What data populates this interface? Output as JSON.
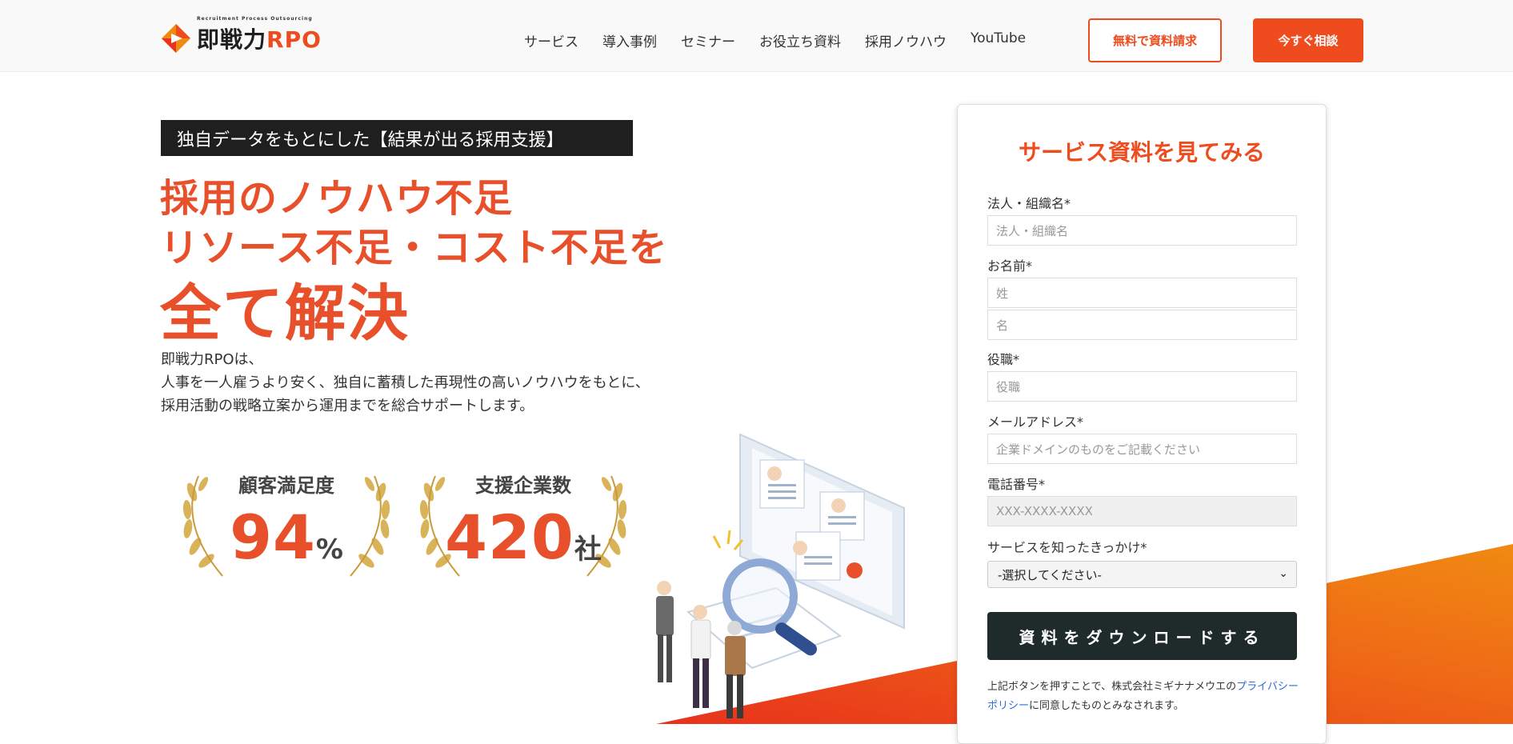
{
  "header": {
    "logo_sub": "Recruitment Process Outsourcing",
    "logo_main_a": "即戦力",
    "logo_main_b": "RPO",
    "nav": [
      "サービス",
      "導入事例",
      "セミナー",
      "お役立ち資料",
      "採用ノウハウ",
      "YouTube"
    ],
    "btn_request": "無料で資料請求",
    "btn_consult": "今すぐ相談"
  },
  "hero": {
    "tagline": "独自データをもとにした【結果が出る採用支援】",
    "headline_line1": "採用のノウハウ不足",
    "headline_line2": "リソース不足・コスト不足を",
    "headline_line3": "全て解決",
    "description": [
      "即戦力RPOは、",
      "人事を一人雇うより安く、独自に蓄積した再現性の高いノウハウをもとに、",
      "採用活動の戦略立案から運用までを総合サポートします。"
    ]
  },
  "awards": [
    {
      "label": "顧客満足度",
      "value": "94",
      "unit": "%"
    },
    {
      "label": "支援企業数",
      "value": "420",
      "unit": "社"
    }
  ],
  "form": {
    "title": "サービス資料を見てみる",
    "org_label": "法人・組織名*",
    "org_placeholder": "法人・組織名",
    "name_label": "お名前*",
    "last_name_placeholder": "姓",
    "first_name_placeholder": "名",
    "position_label": "役職*",
    "position_placeholder": "役職",
    "email_label": "メールアドレス*",
    "email_placeholder": "企業ドメインのものをご記載ください",
    "phone_label": "電話番号*",
    "phone_placeholder": "XXX-XXXX-XXXX",
    "source_label": "サービスを知ったきっかけ*",
    "source_selected": "-選択してください-",
    "download_button": "資料をダウンロードする",
    "notice_before": "上記ボタンを押すことで、株式会社ミギナナメウエの",
    "notice_link": "プライバシーポリシー",
    "notice_after": "に同意したものとみなされます。"
  },
  "colors": {
    "accent": "#ee4c1f",
    "headline": "#e8502b",
    "dark": "#1f1f1f",
    "button_dark": "#1f2b2a",
    "link": "#2b6cd6"
  },
  "icons": [
    "logo-mark-icon",
    "laurel-icon",
    "chevron-down-icon"
  ]
}
